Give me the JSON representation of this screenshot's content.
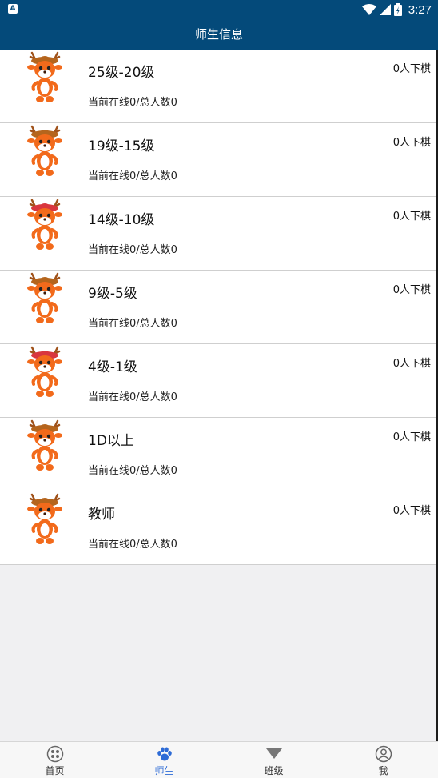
{
  "status_bar": {
    "time": "3:27",
    "notification_badge": "A"
  },
  "header": {
    "title": "师生信息"
  },
  "groups": [
    {
      "title": "25级-20级",
      "playing": "0人下棋",
      "online": "当前在线0/总人数0",
      "icon": "deer-mascot-icon",
      "hat": "#b5651d"
    },
    {
      "title": "19级-15级",
      "playing": "0人下棋",
      "online": "当前在线0/总人数0",
      "icon": "deer-mascot-icon",
      "hat": "#b5651d"
    },
    {
      "title": "14级-10级",
      "playing": "0人下棋",
      "online": "当前在线0/总人数0",
      "icon": "deer-mascot-icon",
      "hat": "#d9363e"
    },
    {
      "title": "9级-5级",
      "playing": "0人下棋",
      "online": "当前在线0/总人数0",
      "icon": "deer-mascot-icon",
      "hat": "#b5651d"
    },
    {
      "title": "4级-1级",
      "playing": "0人下棋",
      "online": "当前在线0/总人数0",
      "icon": "deer-mascot-icon",
      "hat": "#d9363e"
    },
    {
      "title": "1D以上",
      "playing": "0人下棋",
      "online": "当前在线0/总人数0",
      "icon": "deer-mascot-icon",
      "hat": "#b5651d"
    },
    {
      "title": "教师",
      "playing": "0人下棋",
      "online": "当前在线0/总人数0",
      "icon": "deer-mascot-icon",
      "hat": "#b5651d"
    }
  ],
  "bottom_nav": [
    {
      "label": "首页",
      "icon": "home-grid-icon",
      "active": false
    },
    {
      "label": "师生",
      "icon": "paw-icon",
      "active": true
    },
    {
      "label": "班级",
      "icon": "triangle-icon",
      "active": false
    },
    {
      "label": "我",
      "icon": "user-icon",
      "active": false
    }
  ],
  "colors": {
    "header_bg": "#044a7a",
    "active_tab": "#2d6bd6",
    "mascot": "#f26a1b"
  }
}
